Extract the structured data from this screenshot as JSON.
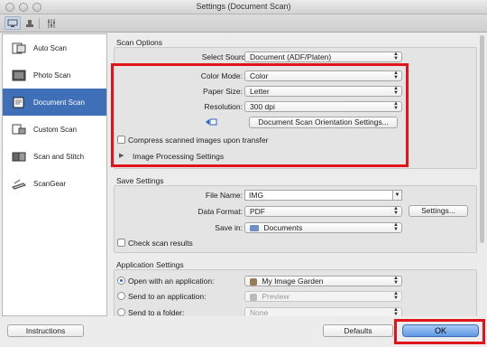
{
  "window": {
    "title": "Settings (Document Scan)"
  },
  "toolbar": {
    "tabs": [
      "scan-from-computer-icon",
      "scan-from-operation-panel-icon",
      "general-settings-icon"
    ]
  },
  "sidebar": {
    "items": [
      {
        "label": "Auto Scan",
        "icon": "auto-scan-icon"
      },
      {
        "label": "Photo Scan",
        "icon": "photo-scan-icon"
      },
      {
        "label": "Document Scan",
        "icon": "document-scan-icon"
      },
      {
        "label": "Custom Scan",
        "icon": "custom-scan-icon"
      },
      {
        "label": "Scan and Stitch",
        "icon": "scan-and-stitch-icon"
      },
      {
        "label": "ScanGear",
        "icon": "scangear-icon"
      }
    ]
  },
  "scan_options": {
    "title": "Scan Options",
    "select_source": {
      "label": "Select Source:",
      "value": "Document (ADF/Platen)"
    },
    "color_mode": {
      "label": "Color Mode:",
      "value": "Color"
    },
    "paper_size": {
      "label": "Paper Size:",
      "value": "Letter"
    },
    "resolution": {
      "label": "Resolution:",
      "value": "300 dpi"
    },
    "orientation_button": "Document Scan Orientation Settings...",
    "compress_label": "Compress scanned images upon transfer",
    "image_processing": "Image Processing Settings"
  },
  "save_settings": {
    "title": "Save Settings",
    "file_name": {
      "label": "File Name:",
      "value": "IMG"
    },
    "data_format": {
      "label": "Data Format:",
      "value": "PDF"
    },
    "settings_button": "Settings...",
    "save_in": {
      "label": "Save in:",
      "value": "Documents"
    },
    "check_results": "Check scan results"
  },
  "app_settings": {
    "title": "Application Settings",
    "open_app": {
      "label": "Open with an application:",
      "value": "My Image Garden"
    },
    "send_app": {
      "label": "Send to an application:",
      "value": "Preview"
    },
    "send_folder": {
      "label": "Send to a folder:",
      "value": "None"
    }
  },
  "footer": {
    "instructions": "Instructions",
    "defaults": "Defaults",
    "ok": "OK"
  },
  "colors": {
    "highlight": "#e1141c",
    "selection": "#3f6fb6"
  }
}
